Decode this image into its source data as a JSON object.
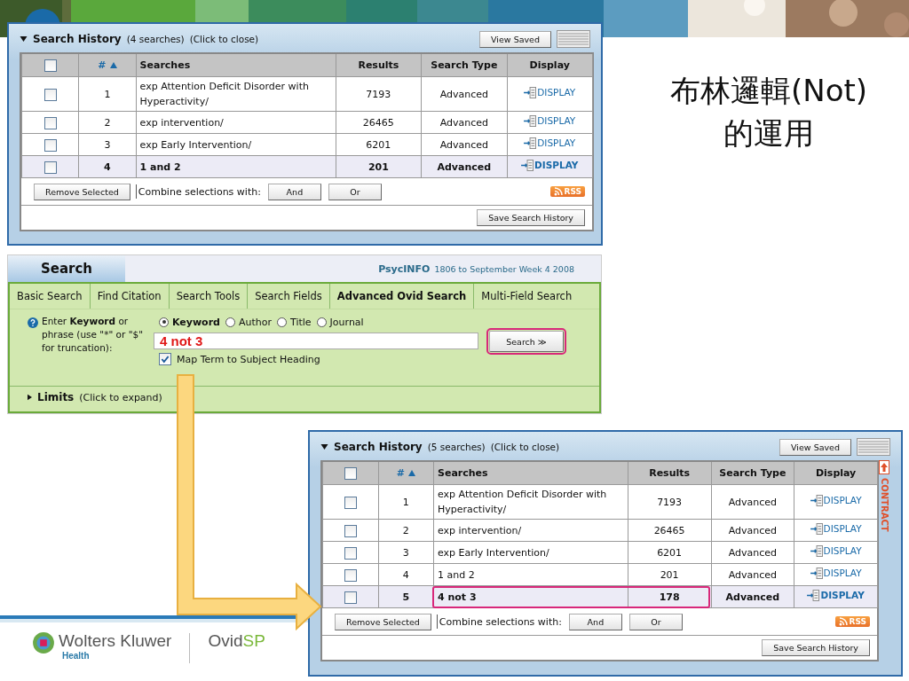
{
  "title_lines": [
    "布林邏輯(Not)",
    "的運用"
  ],
  "histories": [
    {
      "title": "Search History",
      "count": "(4 searches)",
      "hint": "(Click to close)",
      "view_saved": "View Saved",
      "header_checked": false,
      "columns": [
        "#",
        "Searches",
        "Results",
        "Search Type",
        "Display"
      ],
      "rows": [
        {
          "num": "1",
          "search": "exp Attention Deficit Disorder with Hyperactivity/",
          "results": "7193",
          "type": "Advanced",
          "link": "DISPLAY",
          "checked": false,
          "latest": false,
          "callout": false
        },
        {
          "num": "2",
          "search": "exp intervention/",
          "results": "26465",
          "type": "Advanced",
          "link": "DISPLAY",
          "checked": false,
          "latest": false,
          "callout": false
        },
        {
          "num": "3",
          "search": "exp Early Intervention/",
          "results": "6201",
          "type": "Advanced",
          "link": "DISPLAY",
          "checked": false,
          "latest": false,
          "callout": false
        },
        {
          "num": "4",
          "search": "1 and 2",
          "results": "201",
          "type": "Advanced",
          "link": "DISPLAY",
          "checked": false,
          "latest": true,
          "callout": false
        }
      ],
      "remove": "Remove Selected",
      "combine": "Combine selections with:",
      "and": "And",
      "or": "Or",
      "rss": "RSS",
      "save": "Save Search History"
    },
    {
      "title": "Search History",
      "count": "(5 searches)",
      "hint": "(Click to close)",
      "view_saved": "View Saved",
      "header_checked": false,
      "columns": [
        "#",
        "Searches",
        "Results",
        "Search Type",
        "Display"
      ],
      "rows": [
        {
          "num": "1",
          "search": "exp Attention Deficit Disorder with Hyperactivity/",
          "results": "7193",
          "type": "Advanced",
          "link": "DISPLAY",
          "checked": false,
          "latest": false,
          "callout": false
        },
        {
          "num": "2",
          "search": "exp intervention/",
          "results": "26465",
          "type": "Advanced",
          "link": "DISPLAY",
          "checked": false,
          "latest": false,
          "callout": false
        },
        {
          "num": "3",
          "search": "exp Early Intervention/",
          "results": "6201",
          "type": "Advanced",
          "link": "DISPLAY",
          "checked": false,
          "latest": false,
          "callout": false
        },
        {
          "num": "4",
          "search": "1 and 2",
          "results": "201",
          "type": "Advanced",
          "link": "DISPLAY",
          "checked": false,
          "latest": false,
          "callout": false
        },
        {
          "num": "5",
          "search": "4 not 3",
          "results": "178",
          "type": "Advanced",
          "link": "DISPLAY",
          "checked": false,
          "latest": true,
          "callout": true
        }
      ],
      "remove": "Remove Selected",
      "combine": "Combine selections with:",
      "and": "And",
      "or": "Or",
      "rss": "RSS",
      "save": "Save Search History",
      "contract": "CONTRACT"
    }
  ],
  "search": {
    "tab": "Search",
    "database": "PsycINFO",
    "range": "1806 to September Week 4 2008",
    "tabs": [
      {
        "label": "Basic Search",
        "selected": false
      },
      {
        "label": "Find Citation",
        "selected": false
      },
      {
        "label": "Search Tools",
        "selected": false
      },
      {
        "label": "Search Fields",
        "selected": false
      },
      {
        "label": "Advanced Ovid Search",
        "selected": true
      },
      {
        "label": "Multi-Field Search",
        "selected": false
      }
    ],
    "help": "Enter **Keyword** or phrase (use \"*\" or \"$\" for truncation):",
    "fields": [
      {
        "label": "Keyword",
        "selected": true
      },
      {
        "label": "Author",
        "selected": false
      },
      {
        "label": "Title",
        "selected": false
      },
      {
        "label": "Journal",
        "selected": false
      }
    ],
    "query": "4 not 3",
    "button": "Search ≫",
    "button_callout": true,
    "map_term": {
      "label": "Map Term to Subject Heading",
      "checked": true
    },
    "limits": "Limits",
    "limits_hint": "(Click to expand)"
  },
  "footer": {
    "brand": "Wolters Kluwer",
    "division": "Health",
    "product": "Ovid",
    "product_suffix": "SP"
  }
}
